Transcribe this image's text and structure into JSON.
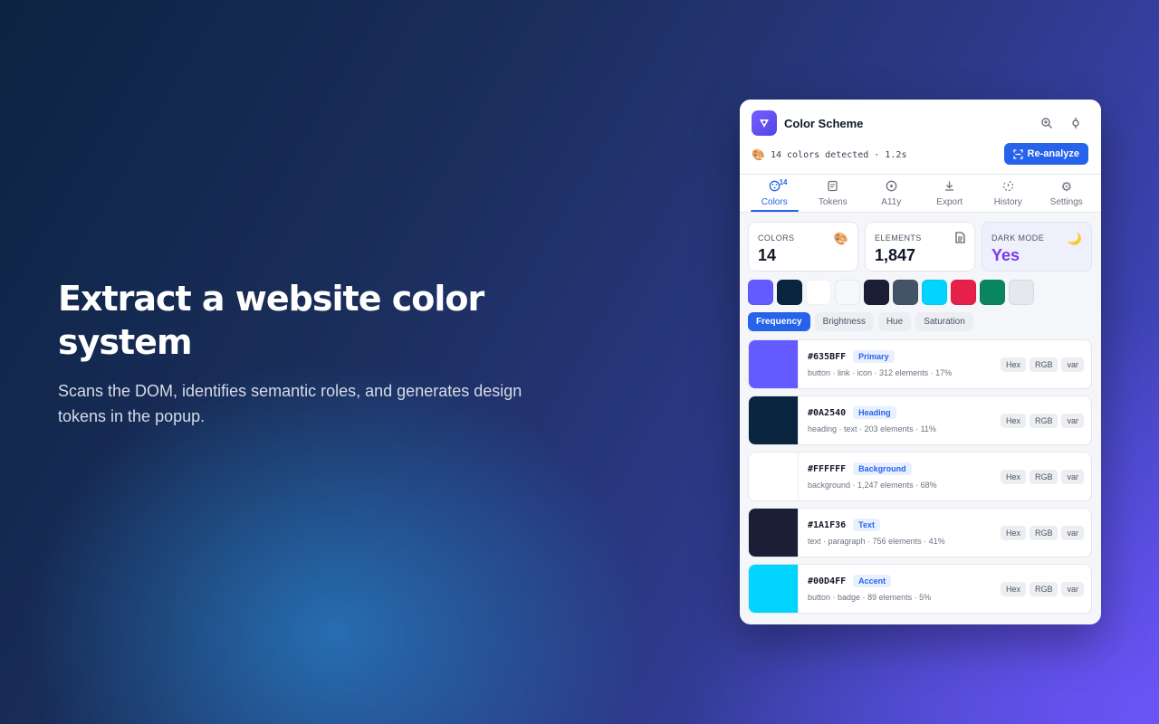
{
  "hero": {
    "title": "Extract a website color system",
    "subtitle": "Scans the DOM, identifies semantic roles, and generates design tokens in the popup."
  },
  "popup": {
    "title": "Color Scheme",
    "status": "14 colors detected · 1.2s",
    "reanalyze_label": "Re-analyze",
    "tabs": [
      {
        "label": "Colors",
        "icon": "palette-icon",
        "count": "14"
      },
      {
        "label": "Tokens",
        "icon": "tokens-icon"
      },
      {
        "label": "A11y",
        "icon": "accessibility-icon"
      },
      {
        "label": "Export",
        "icon": "download-icon"
      },
      {
        "label": "History",
        "icon": "history-icon"
      },
      {
        "label": "Settings",
        "icon": "gear-icon"
      }
    ],
    "stats": [
      {
        "label": "COLORS",
        "value": "14"
      },
      {
        "label": "ELEMENTS",
        "value": "1,847"
      },
      {
        "label": "DARK MODE",
        "value": "Yes"
      }
    ],
    "swatches": [
      "#635BFF",
      "#0A2540",
      "#FFFFFF",
      "#F6F9FC",
      "#1A1F36",
      "#425466",
      "#00D4FF",
      "#E5204A",
      "#0A8560",
      "#E6E8F0"
    ],
    "sort_options": [
      "Frequency",
      "Brightness",
      "Hue",
      "Saturation"
    ],
    "colors": [
      {
        "hex": "#635BFF",
        "role": "Primary",
        "usage": "button · link · icon",
        "elements": "312 elements · 17%",
        "formats": [
          "Hex",
          "RGB",
          "var"
        ]
      },
      {
        "hex": "#0A2540",
        "role": "Heading",
        "usage": "heading · text",
        "elements": "203 elements · 11%",
        "formats": [
          "Hex",
          "RGB",
          "var"
        ]
      },
      {
        "hex": "#FFFFFF",
        "role": "Background",
        "usage": "background",
        "elements": "1,247 elements · 68%",
        "formats": [
          "Hex",
          "RGB",
          "var"
        ]
      },
      {
        "hex": "#1A1F36",
        "role": "Text",
        "usage": "text · paragraph",
        "elements": "756 elements · 41%",
        "formats": [
          "Hex",
          "RGB",
          "var"
        ]
      },
      {
        "hex": "#00D4FF",
        "role": "Accent",
        "usage": "button · badge",
        "elements": "89 elements · 5%",
        "formats": [
          "Hex",
          "RGB",
          "var"
        ]
      }
    ]
  },
  "colors": {
    "accent": "#2563EB",
    "dark_mode_value": "#7C3AED"
  }
}
